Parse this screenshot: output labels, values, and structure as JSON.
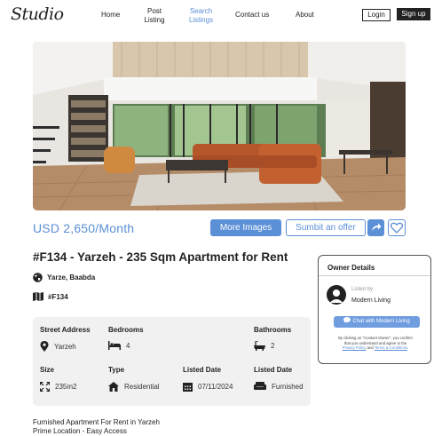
{
  "nav": {
    "logo": "Studio",
    "links": [
      "Home",
      "Post Listing",
      "Search Listings",
      "Contact us",
      "About"
    ],
    "post_listing_lines": [
      "Post",
      "Listing"
    ],
    "search_listings_lines": [
      "Search",
      "Listings"
    ],
    "active": "Search Listings",
    "login": "Login",
    "signup": "Sign up"
  },
  "listing": {
    "price": "USD 2,650/Month",
    "more_images": "More Images",
    "submit_offer": "Sumbit an offer",
    "title": "#F134 - Yarzeh - 235 Sqm Apartment for Rent",
    "location": "Yarze, Baabda",
    "ref": "#F134"
  },
  "details": {
    "street_address_label": "Street Address",
    "street_address": "Yarzeh",
    "bedrooms_label": "Bedrooms",
    "bedrooms": "4",
    "bathrooms_label": "Bathrooms",
    "bathrooms": "2",
    "size_label": "Size",
    "size": "235m2",
    "type_label": "Type",
    "type": "Residential",
    "listed_date_label": "Listed Date",
    "listed_date": "07/11/2024",
    "listed_date2_label": "Listed Date",
    "furnishing": "Furnished"
  },
  "owner": {
    "heading": "Owner Details",
    "listed_by": "Listed by",
    "name": "Modern Living",
    "chat": "Chat with Modern Living",
    "disclaimer_1": "By clicking on \"Contact Owner\", you confirm",
    "disclaimer_2": "that you understand and agree to the",
    "privacy": "Privacy Policy",
    "and": " and ",
    "terms": "Terms & Conditions",
    "period": "."
  },
  "description": {
    "line1": "Furnished Apartment For Rent in Yarzeh",
    "line2": "Prime Location - Easy Access"
  },
  "colors": {
    "accent": "#5b8fd6",
    "dark": "#222222",
    "panel": "#f1f1f1"
  }
}
